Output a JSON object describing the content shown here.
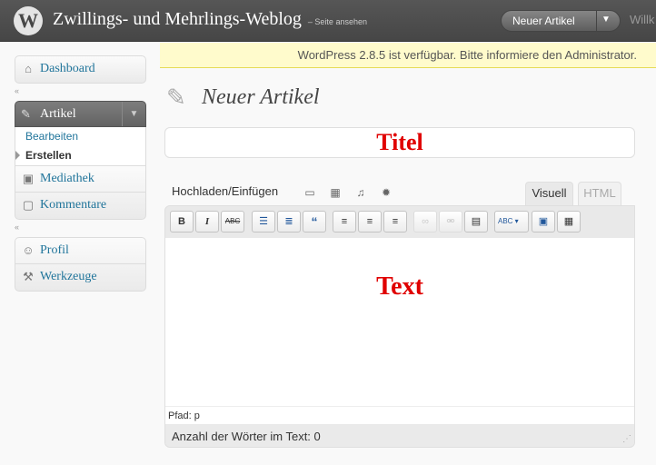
{
  "header": {
    "logo": "W",
    "site_title": "Zwillings- und Mehrlings-Weblog",
    "site_link": "– Seite ansehen",
    "favorite_action": "Neuer Artikel",
    "favorite_arrow": "▼",
    "user": "Willk"
  },
  "notice": {
    "text": "WordPress 2.8.5 ist verfügbar. Bitte informiere den Administrator."
  },
  "sidebar": {
    "dashboard": "Dashboard",
    "collapse": "«",
    "artikel": "Artikel",
    "artikel_sub": [
      "Bearbeiten",
      "Erstellen"
    ],
    "mediathek": "Mediathek",
    "kommentare": "Kommentare",
    "profil": "Profil",
    "werkzeuge": "Werkzeuge"
  },
  "page": {
    "title": "Neuer Artikel",
    "title_field": "Titel",
    "media_label": "Hochladen/Einfügen",
    "tab_visual": "Visuell",
    "tab_html": "HTML",
    "body_text": "Text",
    "path": "Pfad: p",
    "word_count": "Anzahl der Wörter im Text: 0"
  },
  "toolbar": {
    "bold": "B",
    "italic": "I",
    "strike": "ABC",
    "spell": "ABC"
  },
  "colors": {
    "header_bg": "#464646",
    "link": "#21759b",
    "notice_bg": "#fffbcc",
    "annotation_red": "#e00000"
  }
}
